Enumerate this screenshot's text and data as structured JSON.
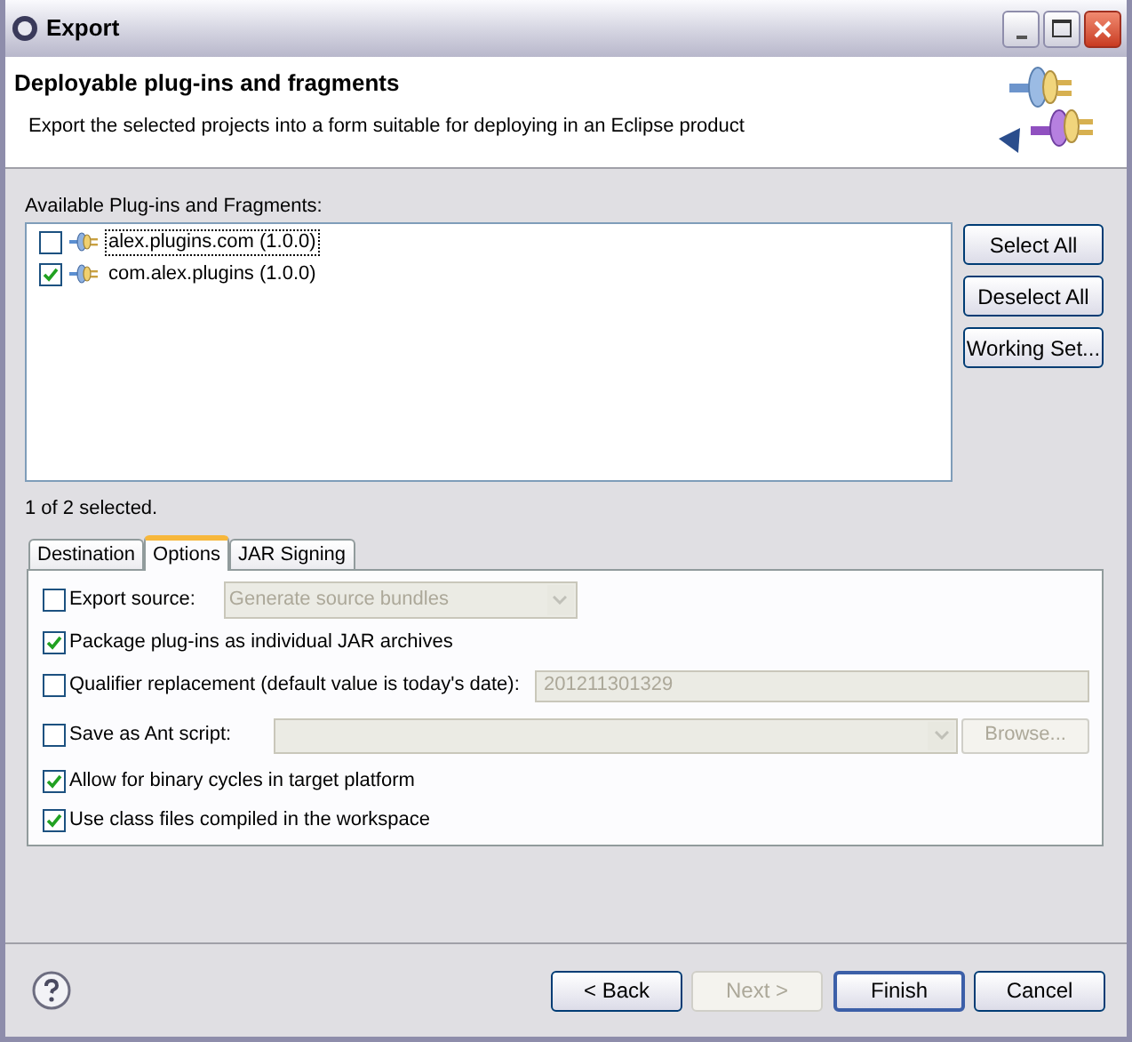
{
  "window": {
    "title": "Export"
  },
  "header": {
    "title": "Deployable plug-ins and fragments",
    "description": "Export the selected projects into a form suitable for deploying in an Eclipse product"
  },
  "plugins": {
    "label": "Available Plug-ins and Fragments:",
    "items": [
      {
        "label": "alex.plugins.com (1.0.0)",
        "checked": false,
        "focused": true
      },
      {
        "label": "com.alex.plugins (1.0.0)",
        "checked": true,
        "focused": false
      }
    ],
    "buttons": [
      "Select All",
      "Deselect All",
      "Working Set..."
    ],
    "status": "1 of 2 selected."
  },
  "tabs": [
    {
      "label": "Destination",
      "selected": false
    },
    {
      "label": "Options",
      "selected": true
    },
    {
      "label": "JAR Signing",
      "selected": false
    }
  ],
  "options": [
    {
      "kind": "dropdown",
      "label": "Export source:",
      "checked": false,
      "value": "Generate source bundles"
    },
    {
      "kind": "check",
      "label": "Package plug-ins as individual JAR archives",
      "checked": true
    },
    {
      "kind": "text",
      "label": "Qualifier replacement (default value is today's date):",
      "checked": false,
      "value": "201211301329"
    },
    {
      "kind": "browse",
      "label": "Save as Ant script:",
      "checked": false,
      "button": "Browse..."
    },
    {
      "kind": "check",
      "label": "Allow for binary cycles in target platform",
      "checked": true
    },
    {
      "kind": "check",
      "label": "Use class files compiled in the workspace",
      "checked": true
    }
  ],
  "footer": [
    {
      "label": "< Back",
      "disabled": false,
      "default": false
    },
    {
      "label": "Next >",
      "disabled": true,
      "default": false
    },
    {
      "label": "Finish",
      "disabled": false,
      "default": true
    },
    {
      "label": "Cancel",
      "disabled": false,
      "default": false
    }
  ]
}
